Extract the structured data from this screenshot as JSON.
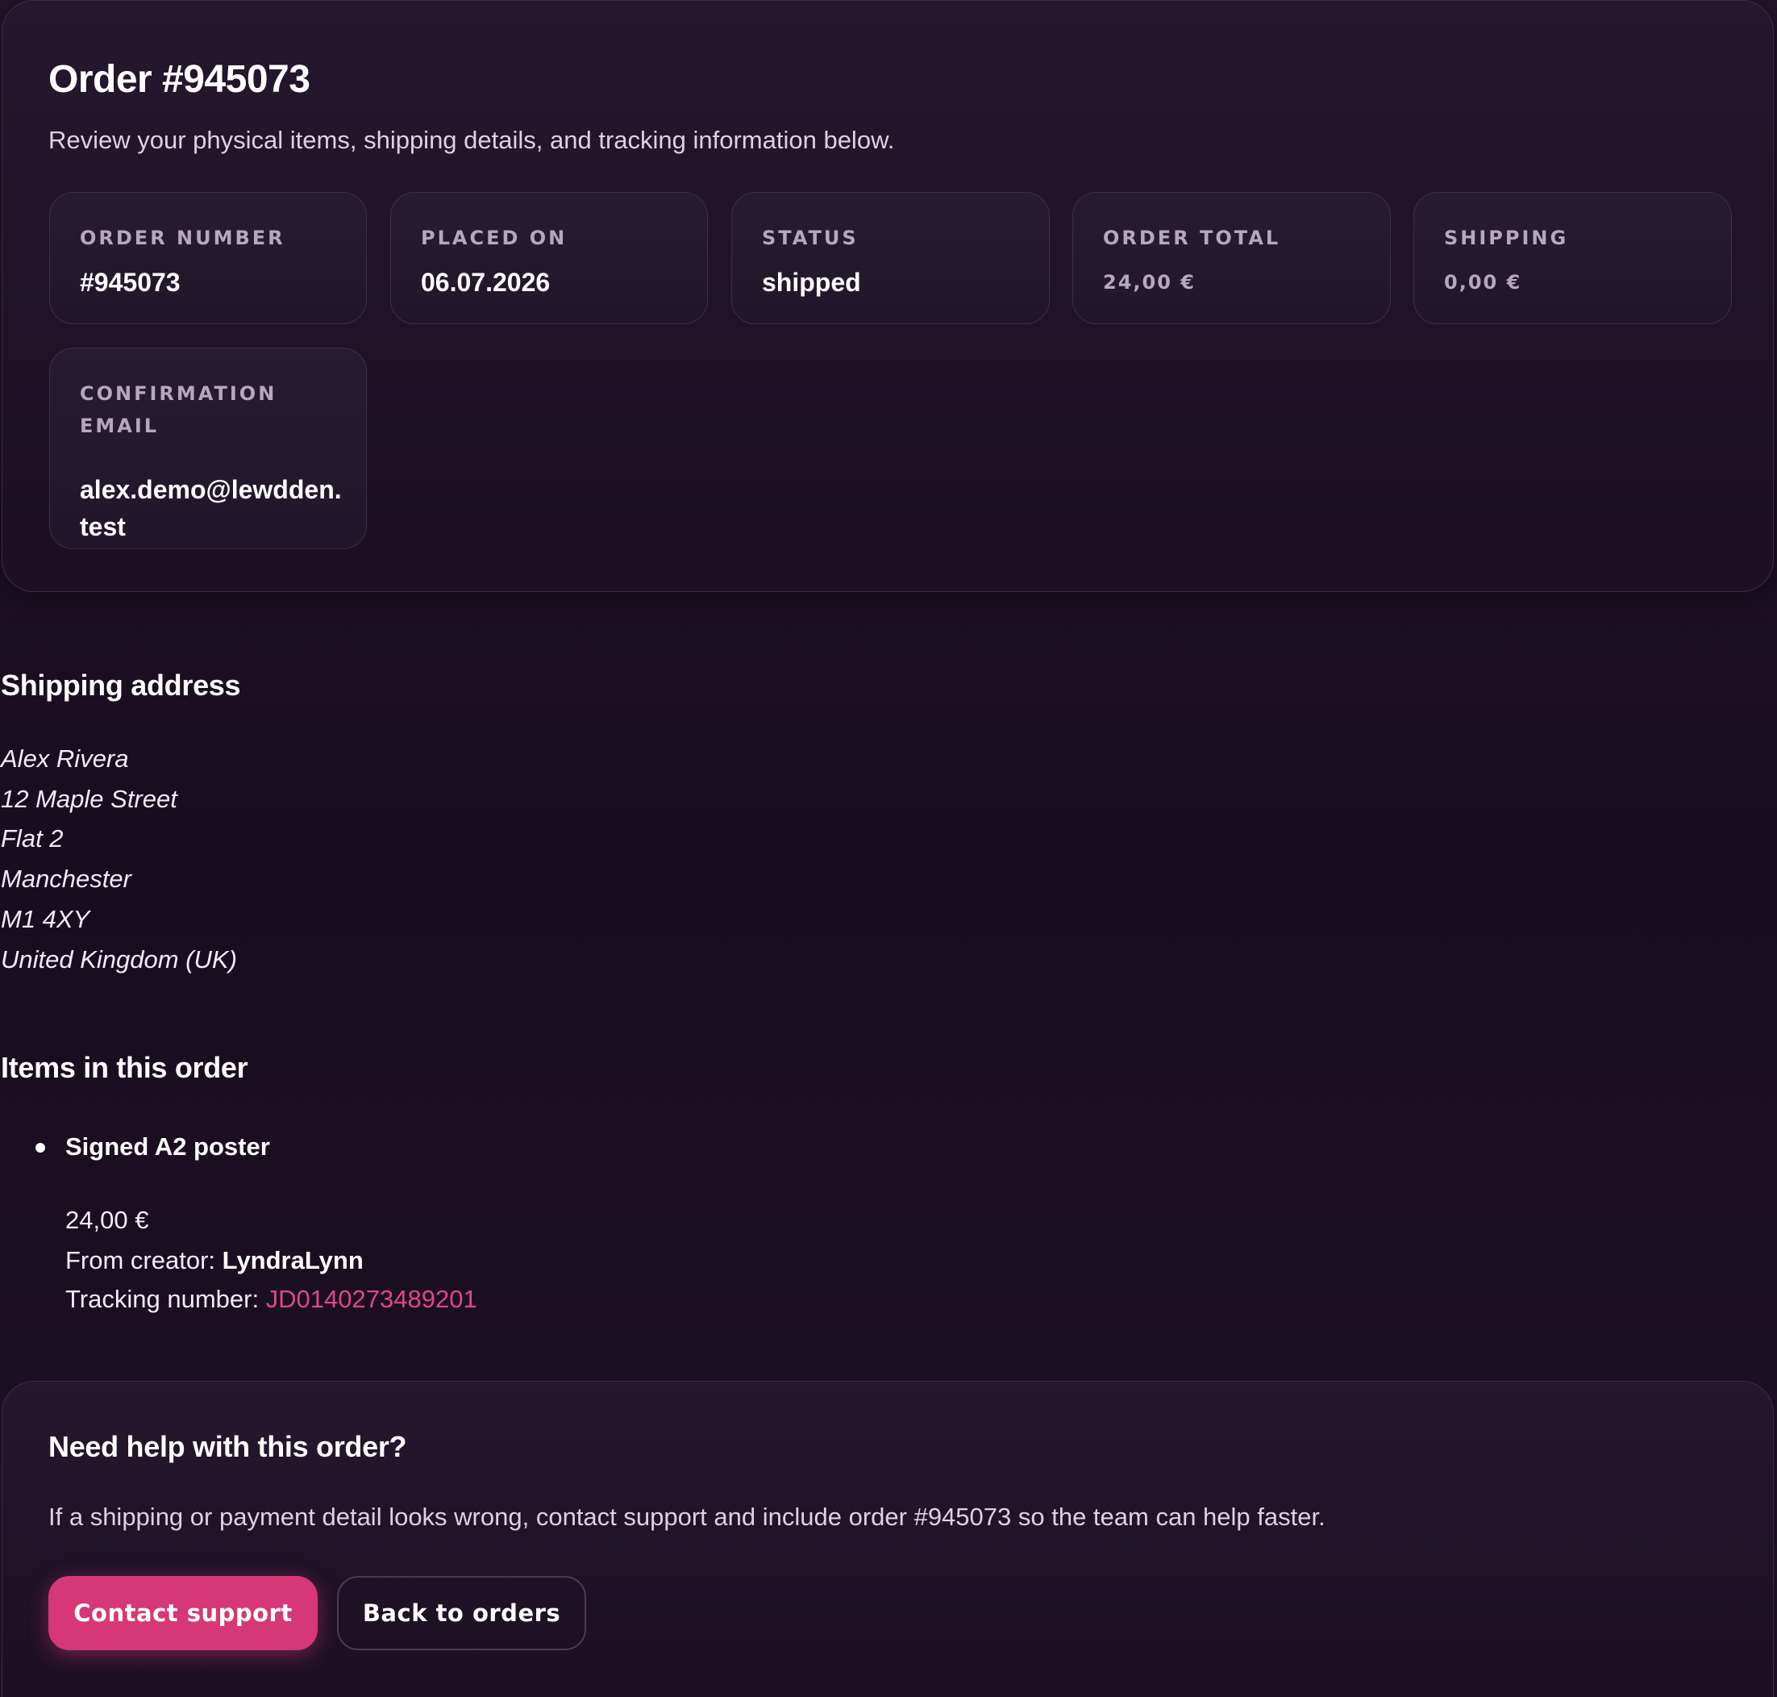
{
  "header": {
    "title": "Order #945073",
    "subtitle": "Review your physical items, shipping details, and tracking information below."
  },
  "summary": {
    "order_number": {
      "label": "Order number",
      "value": "#945073"
    },
    "placed_on": {
      "label": "Placed on",
      "value": "06.07.2026"
    },
    "status": {
      "label": "Status",
      "value": "shipped"
    },
    "order_total": {
      "label": "Order total",
      "value": "24,00 €"
    },
    "shipping": {
      "label": "Shipping",
      "value": "0,00 €"
    },
    "confirmation_email": {
      "label": "Confirmation email",
      "value": "alex.demo@lewdden.test"
    }
  },
  "shipping_address": {
    "title": "Shipping address",
    "lines": [
      "Alex Rivera",
      "12 Maple Street",
      "Flat 2",
      "Manchester",
      "M1 4XY",
      "United Kingdom (UK)"
    ]
  },
  "items": {
    "title": "Items in this order",
    "list": [
      {
        "name": "Signed A2 poster",
        "price": "24,00 €",
        "creator_label": "From creator: ",
        "creator": "LyndraLynn",
        "tracking_label": "Tracking number: ",
        "tracking_number": "JD0140273489201"
      }
    ]
  },
  "help": {
    "title": "Need help with this order?",
    "text": "If a shipping or payment detail looks wrong, contact support and include order #945073 so the team can help faster.",
    "contact_label": "Contact support",
    "back_label": "Back to orders"
  },
  "colors": {
    "background": "#1d1024",
    "accent": "#d63877",
    "link": "#e0468b",
    "muted_label": "#b6a8bc"
  }
}
